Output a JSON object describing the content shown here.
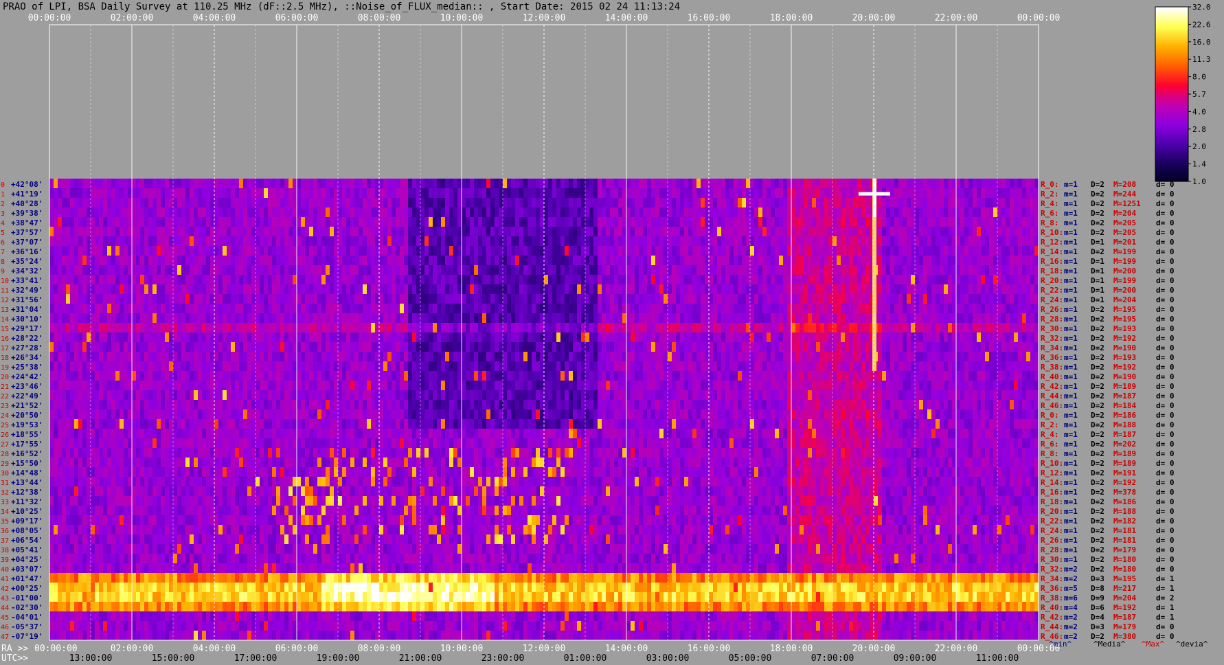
{
  "title": "PRAO of LPI, BSA Daily Survey at 110.25 MHz (dF::2.5 MHz), ::Noise_of_FLUX_median:: , Start Date: 2015 02 24 11:13:24",
  "chart_data": {
    "type": "heatmap",
    "title": "PRAO of LPI, BSA Daily Survey at 110.25 MHz (dF::2.5 MHz), ::Noise_of_FLUX_median:: , Start Date: 2015 02 24 11:13:24",
    "x_label_left_bottom": "RA >>",
    "x_label_left_utc": "UTC>>",
    "x_ticks_top": [
      "00:00:00",
      "02:00:00",
      "04:00:00",
      "06:00:00",
      "08:00:00",
      "10:00:00",
      "12:00:00",
      "14:00:00",
      "16:00:00",
      "18:00:00",
      "20:00:00",
      "22:00:00",
      "00:00:00"
    ],
    "x_ticks_ra": [
      "00:00:00",
      "02:00:00",
      "04:00:00",
      "06:00:00",
      "08:00:00",
      "10:00:00",
      "12:00:00",
      "14:00:00",
      "16:00:00",
      "18:00:00",
      "20:00:00",
      "22:00:00",
      "00:00:00"
    ],
    "x_ticks_utc": [
      "13:00:00",
      "15:00:00",
      "17:00:00",
      "19:00:00",
      "21:00:00",
      "23:00:00",
      "01:00:00",
      "03:00:00",
      "05:00:00",
      "07:00:00",
      "09:00:00",
      "11:00:00"
    ],
    "x_range_hours": [
      0,
      24
    ],
    "declinations": [
      "+42°08'",
      "+41°19'",
      "+40°28'",
      "+39°38'",
      "+38°47'",
      "+37°57'",
      "+37°07'",
      "+36°16'",
      "+35°24'",
      "+34°32'",
      "+33°41'",
      "+32°49'",
      "+31°56'",
      "+31°04'",
      "+30°10'",
      "+29°17'",
      "+28°22'",
      "+27°28'",
      "+26°34'",
      "+25°38'",
      "+24°42'",
      "+23°46'",
      "+22°49'",
      "+21°52'",
      "+20°50'",
      "+19°53'",
      "+18°55'",
      "+17°55'",
      "+16°52'",
      "+15°50'",
      "+14°48'",
      "+13°44'",
      "+12°38'",
      "+11°32'",
      "+10°25'",
      "+09°17'",
      "+08°05'",
      "+06°54'",
      "+05°41'",
      "+04°25'",
      "+03°07'",
      "+01°47'",
      "+00°25'",
      "-01°00'",
      "-02°30'",
      "-04°01'",
      "-05°37'",
      "-07°19'"
    ],
    "colorbar": {
      "ticks": [
        "32.0",
        "22.6",
        "16.0",
        "11.3",
        "8.0",
        "5.7",
        "4.0",
        "2.8",
        "2.0",
        "1.4",
        "1.0"
      ],
      "range": [
        1.0,
        32.0
      ],
      "scale": "log",
      "colors": [
        "#000020",
        "#1a0060",
        "#5000b0",
        "#9000e0",
        "#c000b0",
        "#ff0030",
        "#ff6000",
        "#ffb000",
        "#ffff50",
        "#ffffff"
      ]
    },
    "beam_stats": [
      {
        "name": "R_0:",
        "min": "m=1",
        "med": "D=2",
        "max": "M=208",
        "dev": "d= 0"
      },
      {
        "name": "R_2:",
        "min": "m=1",
        "med": "D=2",
        "max": "M=244",
        "dev": "d= 0"
      },
      {
        "name": "R_4:",
        "min": "m=1",
        "med": "D=2",
        "max": "M=1251",
        "dev": "d= 0"
      },
      {
        "name": "R_6:",
        "min": "m=1",
        "med": "D=2",
        "max": "M=204",
        "dev": "d= 0"
      },
      {
        "name": "R_8:",
        "min": "m=1",
        "med": "D=2",
        "max": "M=205",
        "dev": "d= 0"
      },
      {
        "name": "R_10:",
        "min": "m=1",
        "med": "D=2",
        "max": "M=205",
        "dev": "d= 0"
      },
      {
        "name": "R_12:",
        "min": "m=1",
        "med": "D=1",
        "max": "M=201",
        "dev": "d= 0"
      },
      {
        "name": "R_14:",
        "min": "m=1",
        "med": "D=2",
        "max": "M=199",
        "dev": "d= 0"
      },
      {
        "name": "R_16:",
        "min": "m=1",
        "med": "D=1",
        "max": "M=199",
        "dev": "d= 0"
      },
      {
        "name": "R_18:",
        "min": "m=1",
        "med": "D=1",
        "max": "M=200",
        "dev": "d= 0"
      },
      {
        "name": "R_20:",
        "min": "m=1",
        "med": "D=1",
        "max": "M=199",
        "dev": "d= 0"
      },
      {
        "name": "R_22:",
        "min": "m=1",
        "med": "D=1",
        "max": "M=200",
        "dev": "d= 0"
      },
      {
        "name": "R_24:",
        "min": "m=1",
        "med": "D=1",
        "max": "M=204",
        "dev": "d= 0"
      },
      {
        "name": "R_26:",
        "min": "m=1",
        "med": "D=2",
        "max": "M=195",
        "dev": "d= 0"
      },
      {
        "name": "R_28:",
        "min": "m=1",
        "med": "D=2",
        "max": "M=195",
        "dev": "d= 0"
      },
      {
        "name": "R_30:",
        "min": "m=1",
        "med": "D=2",
        "max": "M=193",
        "dev": "d= 0"
      },
      {
        "name": "R_32:",
        "min": "m=1",
        "med": "D=2",
        "max": "M=192",
        "dev": "d= 0"
      },
      {
        "name": "R_34:",
        "min": "m=1",
        "med": "D=2",
        "max": "M=190",
        "dev": "d= 0"
      },
      {
        "name": "R_36:",
        "min": "m=1",
        "med": "D=2",
        "max": "M=193",
        "dev": "d= 0"
      },
      {
        "name": "R_38:",
        "min": "m=1",
        "med": "D=2",
        "max": "M=192",
        "dev": "d= 0"
      },
      {
        "name": "R_40:",
        "min": "m=1",
        "med": "D=2",
        "max": "M=190",
        "dev": "d= 0"
      },
      {
        "name": "R_42:",
        "min": "m=1",
        "med": "D=2",
        "max": "M=189",
        "dev": "d= 0"
      },
      {
        "name": "R_44:",
        "min": "m=1",
        "med": "D=2",
        "max": "M=187",
        "dev": "d= 0"
      },
      {
        "name": "R_46:",
        "min": "m=1",
        "med": "D=2",
        "max": "M=184",
        "dev": "d= 0"
      },
      {
        "name": "R_0:",
        "min": "m=1",
        "med": "D=2",
        "max": "M=186",
        "dev": "d= 0"
      },
      {
        "name": "R_2:",
        "min": "m=1",
        "med": "D=2",
        "max": "M=188",
        "dev": "d= 0"
      },
      {
        "name": "R_4:",
        "min": "m=1",
        "med": "D=2",
        "max": "M=187",
        "dev": "d= 0"
      },
      {
        "name": "R_6:",
        "min": "m=1",
        "med": "D=2",
        "max": "M=202",
        "dev": "d= 0"
      },
      {
        "name": "R_8:",
        "min": "m=1",
        "med": "D=2",
        "max": "M=189",
        "dev": "d= 0"
      },
      {
        "name": "R_10:",
        "min": "m=1",
        "med": "D=2",
        "max": "M=189",
        "dev": "d= 0"
      },
      {
        "name": "R_12:",
        "min": "m=1",
        "med": "D=2",
        "max": "M=191",
        "dev": "d= 0"
      },
      {
        "name": "R_14:",
        "min": "m=1",
        "med": "D=2",
        "max": "M=192",
        "dev": "d= 0"
      },
      {
        "name": "R_16:",
        "min": "m=1",
        "med": "D=2",
        "max": "M=378",
        "dev": "d= 0"
      },
      {
        "name": "R_18:",
        "min": "m=1",
        "med": "D=2",
        "max": "M=186",
        "dev": "d= 0"
      },
      {
        "name": "R_20:",
        "min": "m=1",
        "med": "D=2",
        "max": "M=188",
        "dev": "d= 0"
      },
      {
        "name": "R_22:",
        "min": "m=1",
        "med": "D=2",
        "max": "M=182",
        "dev": "d= 0"
      },
      {
        "name": "R_24:",
        "min": "m=1",
        "med": "D=2",
        "max": "M=181",
        "dev": "d= 0"
      },
      {
        "name": "R_26:",
        "min": "m=1",
        "med": "D=2",
        "max": "M=181",
        "dev": "d= 0"
      },
      {
        "name": "R_28:",
        "min": "m=1",
        "med": "D=2",
        "max": "M=179",
        "dev": "d= 0"
      },
      {
        "name": "R_30:",
        "min": "m=1",
        "med": "D=2",
        "max": "M=180",
        "dev": "d= 0"
      },
      {
        "name": "R_32:",
        "min": "m=2",
        "med": "D=2",
        "max": "M=180",
        "dev": "d= 0"
      },
      {
        "name": "R_34:",
        "min": "m=2",
        "med": "D=3",
        "max": "M=195",
        "dev": "d= 1"
      },
      {
        "name": "R_36:",
        "min": "m=5",
        "med": "D=8",
        "max": "M=217",
        "dev": "d= 1"
      },
      {
        "name": "R_38:",
        "min": "m=6",
        "med": "D=9",
        "max": "M=204",
        "dev": "d= 2"
      },
      {
        "name": "R_40:",
        "min": "m=4",
        "med": "D=6",
        "max": "M=192",
        "dev": "d= 1"
      },
      {
        "name": "R_42:",
        "min": "m=2",
        "med": "D=4",
        "max": "M=187",
        "dev": "d= 1"
      },
      {
        "name": "R_44:",
        "min": "m=2",
        "med": "D=3",
        "max": "M=179",
        "dev": "d= 0"
      },
      {
        "name": "R_46:",
        "min": "m=2",
        "med": "D=2",
        "max": "M=380",
        "dev": "d= 0"
      }
    ],
    "stats_legend": {
      "min": "^min^",
      "median": "^Media^",
      "max": "^Max^",
      "dev": "^devia^"
    },
    "colors": {
      "background": "#9e9e9e",
      "grid": "#ffffff",
      "label_red": "#cc0000",
      "label_blue": "#000080",
      "label_black": "#000000"
    }
  }
}
